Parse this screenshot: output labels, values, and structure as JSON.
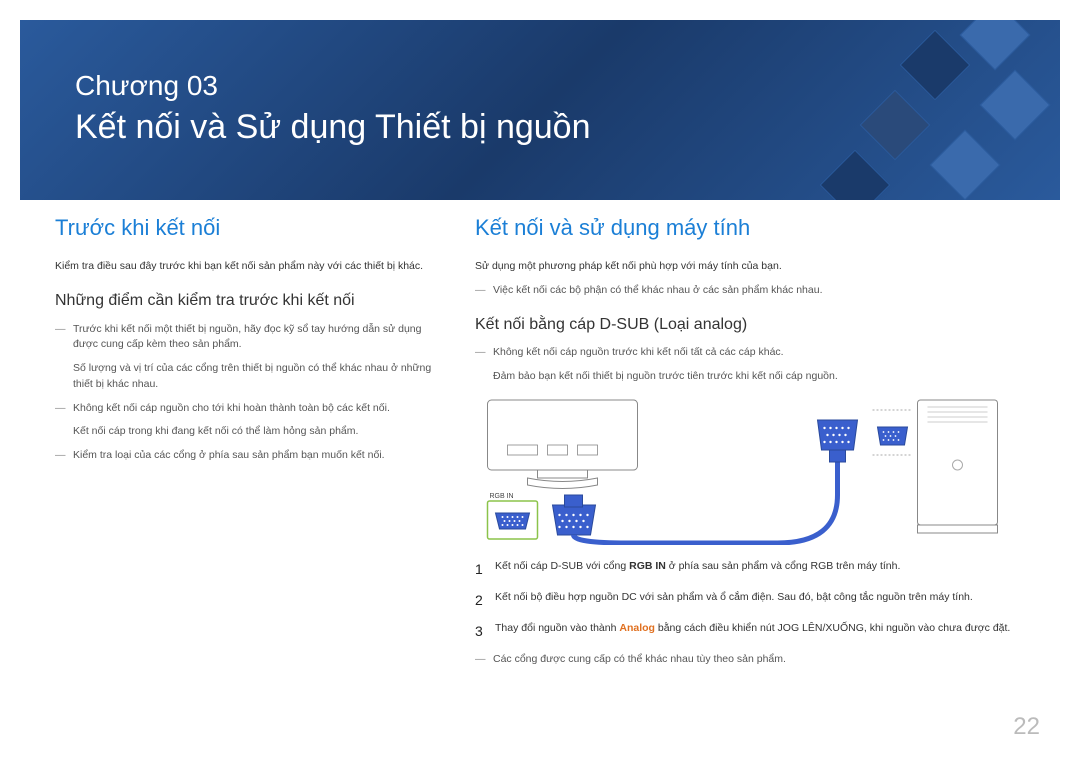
{
  "header": {
    "chapter_label": "Chương 03",
    "chapter_title": "Kết nối và Sử dụng Thiết bị nguồn"
  },
  "left": {
    "section_title": "Trước khi kết nối",
    "intro": "Kiểm tra điều sau đây trước khi bạn kết nối sản phẩm này với các thiết bị khác.",
    "subsection_title": "Những điểm cần kiểm tra trước khi kết nối",
    "bullets": {
      "b1": "Trước khi kết nối một thiết bị nguồn, hãy đọc kỹ sổ tay hướng dẫn sử dụng được cung cấp kèm theo sản phẩm.",
      "b1_sub": "Số lượng và vị trí của các cổng trên thiết bị nguồn có thể khác nhau ở những thiết bị khác nhau.",
      "b2": "Không kết nối cáp nguồn cho tới khi hoàn thành toàn bộ các kết nối.",
      "b2_sub": "Kết nối cáp trong khi đang kết nối có thể làm hỏng sản phẩm.",
      "b3": "Kiểm tra loại của các cổng ở phía sau sản phẩm bạn muốn kết nối."
    }
  },
  "right": {
    "section_title": "Kết nối và sử dụng máy tính",
    "intro": "Sử dụng một phương pháp kết nối phù hợp với máy tính của bạn.",
    "note1": "Việc kết nối các bộ phận có thể khác nhau ở các sản phẩm khác nhau.",
    "subsection_title": "Kết nối bằng cáp D-SUB (Loại analog)",
    "warn1": "Không kết nối cáp nguồn trước khi kết nối tất cả các cáp khác.",
    "warn1_sub": "Đảm bảo bạn kết nối thiết bị nguồn trước tiên trước khi kết nối cáp nguồn.",
    "diagram_label": "RGB IN",
    "steps": {
      "s1_num": "1",
      "s1_a": "Kết nối cáp D-SUB với cổng ",
      "s1_bold": "RGB IN",
      "s1_b": " ở phía sau sản phẩm và cổng RGB trên máy tính.",
      "s2_num": "2",
      "s2": "Kết nối bộ điều hợp nguồn DC với sản phẩm và ổ cắm điện. Sau đó, bật công tắc nguồn trên máy tính.",
      "s3_num": "3",
      "s3_a": "Thay đổi nguồn vào thành ",
      "s3_orange": "Analog",
      "s3_b": " bằng cách điều khiển nút JOG LÊN/XUỐNG, khi nguồn vào chưa được đặt."
    },
    "note2": "Các cổng được cung cấp có thể khác nhau tùy theo sản phẩm."
  },
  "page_number": "22"
}
